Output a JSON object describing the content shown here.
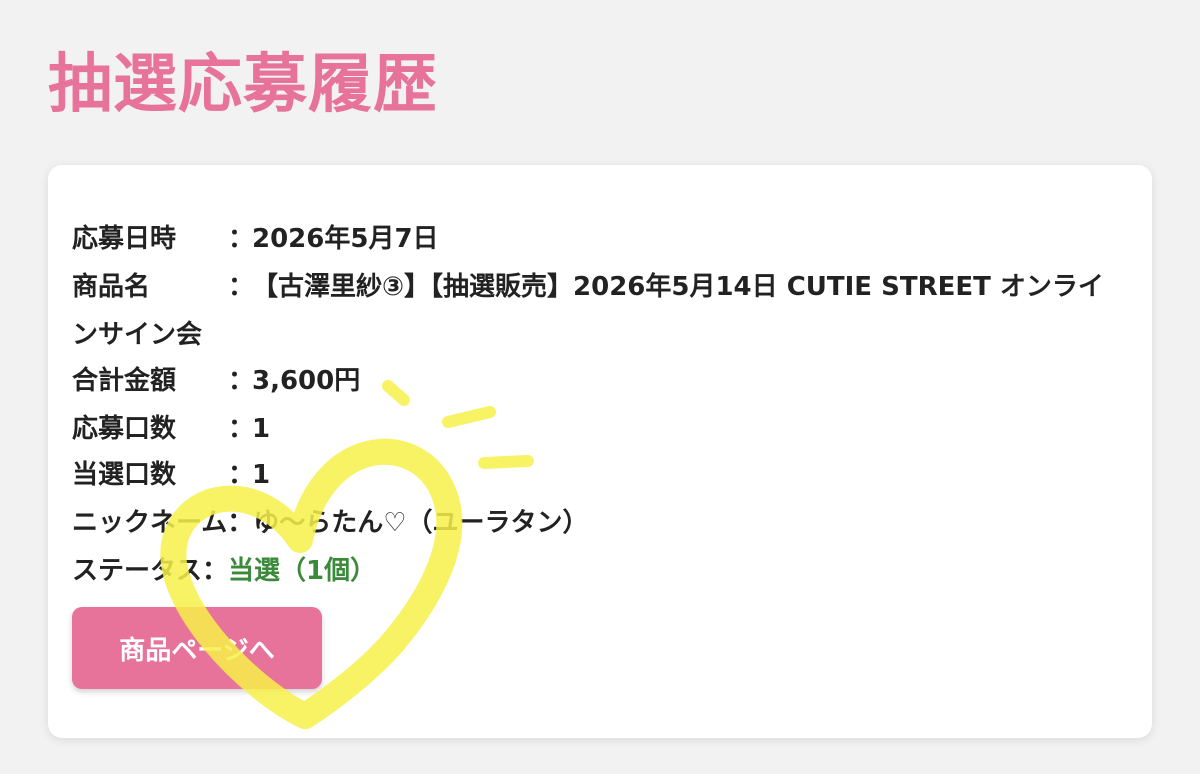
{
  "page": {
    "title": "抽選応募履歴"
  },
  "history": {
    "entry_date": {
      "label": "応募日時",
      "sep": "：",
      "value": "2026年5月7日"
    },
    "product_name": {
      "label": "商品名",
      "sep": "：",
      "value": "【古澤里紗③】【抽選販売】2026年5月14日 CUTIE STREET オンラインサイン会"
    },
    "total_amount": {
      "label": "合計金額",
      "sep": "：",
      "value": "3,600円"
    },
    "entries": {
      "label": "応募口数",
      "sep": "：",
      "value": "1"
    },
    "winning_entries": {
      "label": "当選口数",
      "sep": "：",
      "value": "1"
    },
    "nickname": {
      "label": "ニックネーム",
      "sep": "：",
      "value": "ゆ〜らたん♡（ユーラタン）"
    },
    "status": {
      "label": "ステータス",
      "sep": "：",
      "value": "当選（1個）",
      "color": "#3a8a3a"
    }
  },
  "button": {
    "label": "商品ページへ"
  },
  "colors": {
    "accent": "#e8739a",
    "doodle": "#f7f04a"
  },
  "icons": {
    "doodle": "heart-doodle-icon"
  }
}
